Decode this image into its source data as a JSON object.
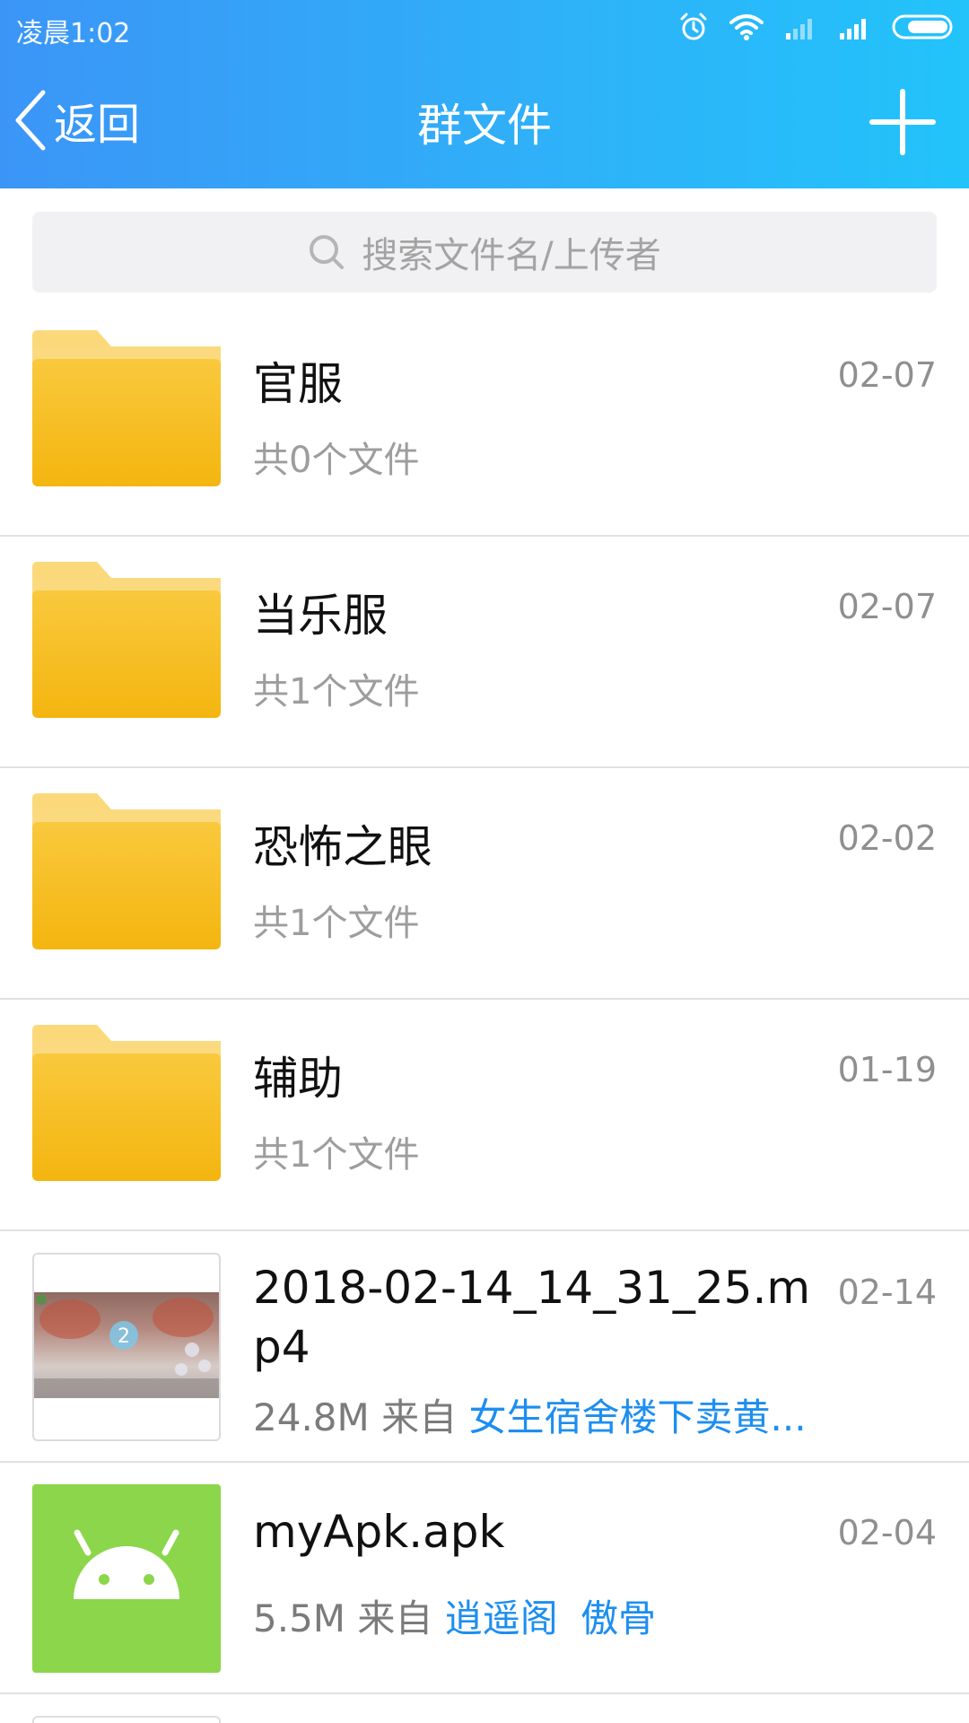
{
  "status_bar": {
    "time": "凌晨1:02"
  },
  "nav": {
    "back_label": "返回",
    "title": "群文件"
  },
  "search": {
    "placeholder": "搜索文件名/上传者"
  },
  "folders": [
    {
      "name": "官服",
      "count": "共0个文件",
      "date": "02-07"
    },
    {
      "name": "当乐服",
      "count": "共1个文件",
      "date": "02-07"
    },
    {
      "name": "恐怖之眼",
      "count": "共1个文件",
      "date": "02-02"
    },
    {
      "name": "辅助",
      "count": "共1个文件",
      "date": "01-19"
    }
  ],
  "files": [
    {
      "name": "2018-02-14_14_31_25.mp4",
      "size": "24.8M",
      "from_label": "来自",
      "uploader": "女生宿舍楼下卖黄...",
      "date": "02-14",
      "type": "video"
    },
    {
      "name": "myApk.apk",
      "size": "5.5M",
      "from_label": "来自",
      "uploader": "逍遥阁",
      "uploader2": "傲骨",
      "date": "02-04",
      "type": "apk"
    }
  ],
  "colors": {
    "header_start": "#3b95f7",
    "header_end": "#22c3fb",
    "folder": "#f7bd1f",
    "link": "#1d8ef0",
    "apk": "#8bd64a"
  }
}
